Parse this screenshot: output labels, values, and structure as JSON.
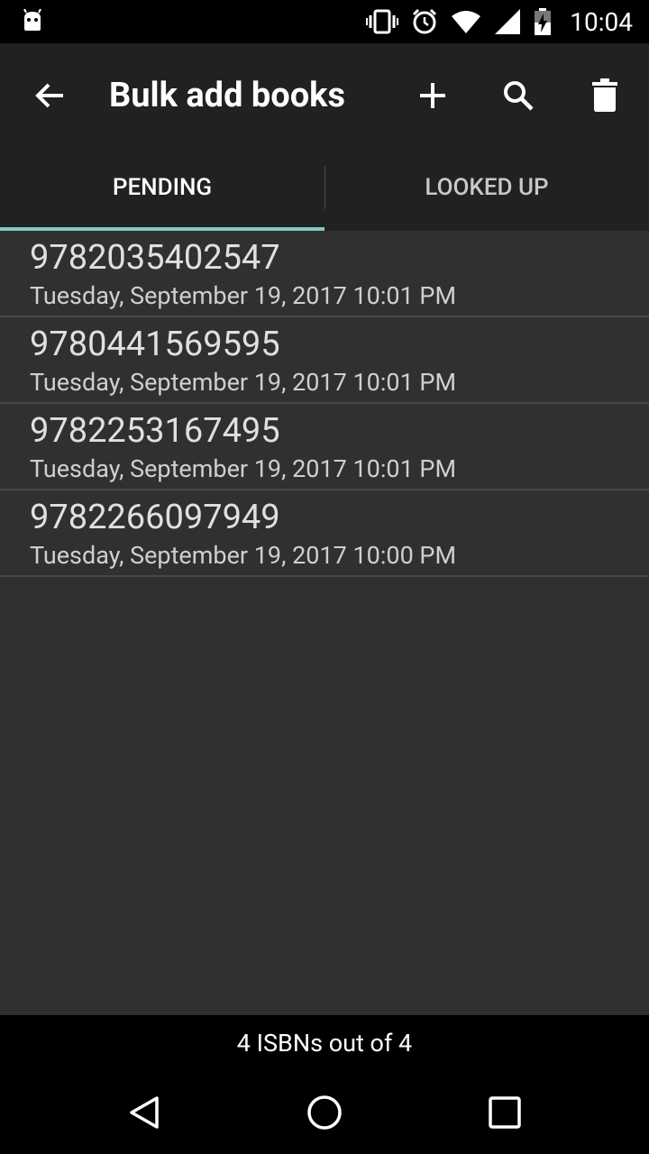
{
  "status_bar": {
    "time": "10:04"
  },
  "toolbar": {
    "title": "Bulk add books",
    "back_icon": "arrow-left-icon",
    "add_icon": "plus-icon",
    "search_icon": "search-icon",
    "delete_icon": "trash-icon"
  },
  "tabs": [
    {
      "label": "PENDING",
      "active": true
    },
    {
      "label": "LOOKED UP",
      "active": false
    }
  ],
  "accent_color": "#80cbc4",
  "items": [
    {
      "isbn": "9782035402547",
      "date": "Tuesday, September 19, 2017 10:01 PM"
    },
    {
      "isbn": "9780441569595",
      "date": "Tuesday, September 19, 2017 10:01 PM"
    },
    {
      "isbn": "9782253167495",
      "date": "Tuesday, September 19, 2017 10:01 PM"
    },
    {
      "isbn": "9782266097949",
      "date": "Tuesday, September 19, 2017 10:00 PM"
    }
  ],
  "footer": {
    "count_text": "4 ISBNs out of 4"
  }
}
